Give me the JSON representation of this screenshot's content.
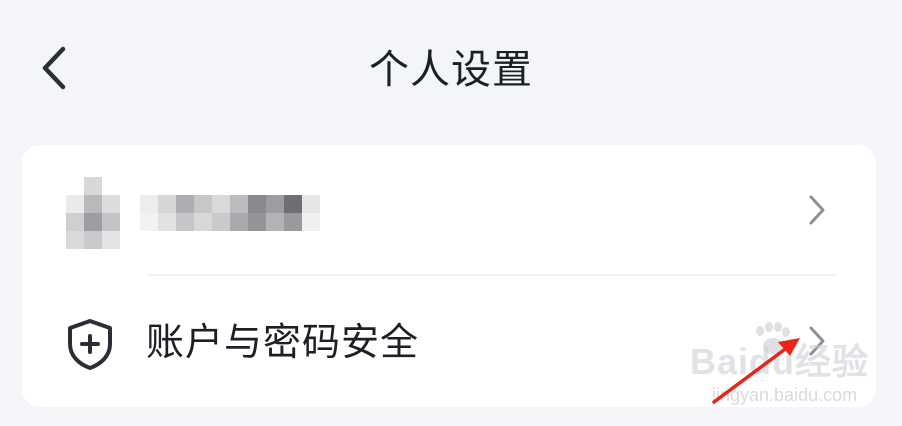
{
  "header": {
    "title": "个人设置",
    "back_icon": "chevron-left-icon"
  },
  "profile_row": {
    "avatar": "pixelated-avatar",
    "name": "",
    "chevron_icon": "chevron-right-icon"
  },
  "security_row": {
    "icon": "shield-plus-icon",
    "label": "账户与密码安全",
    "chevron_icon": "chevron-right-icon"
  },
  "watermark": {
    "brand": "Baidu经验",
    "url": "jingyan.baidu.com"
  },
  "colors": {
    "background": "#f4f5f9",
    "card": "#ffffff",
    "text": "#1c1f26",
    "chevron": "#8d9097",
    "annotation": "#e8251c"
  }
}
